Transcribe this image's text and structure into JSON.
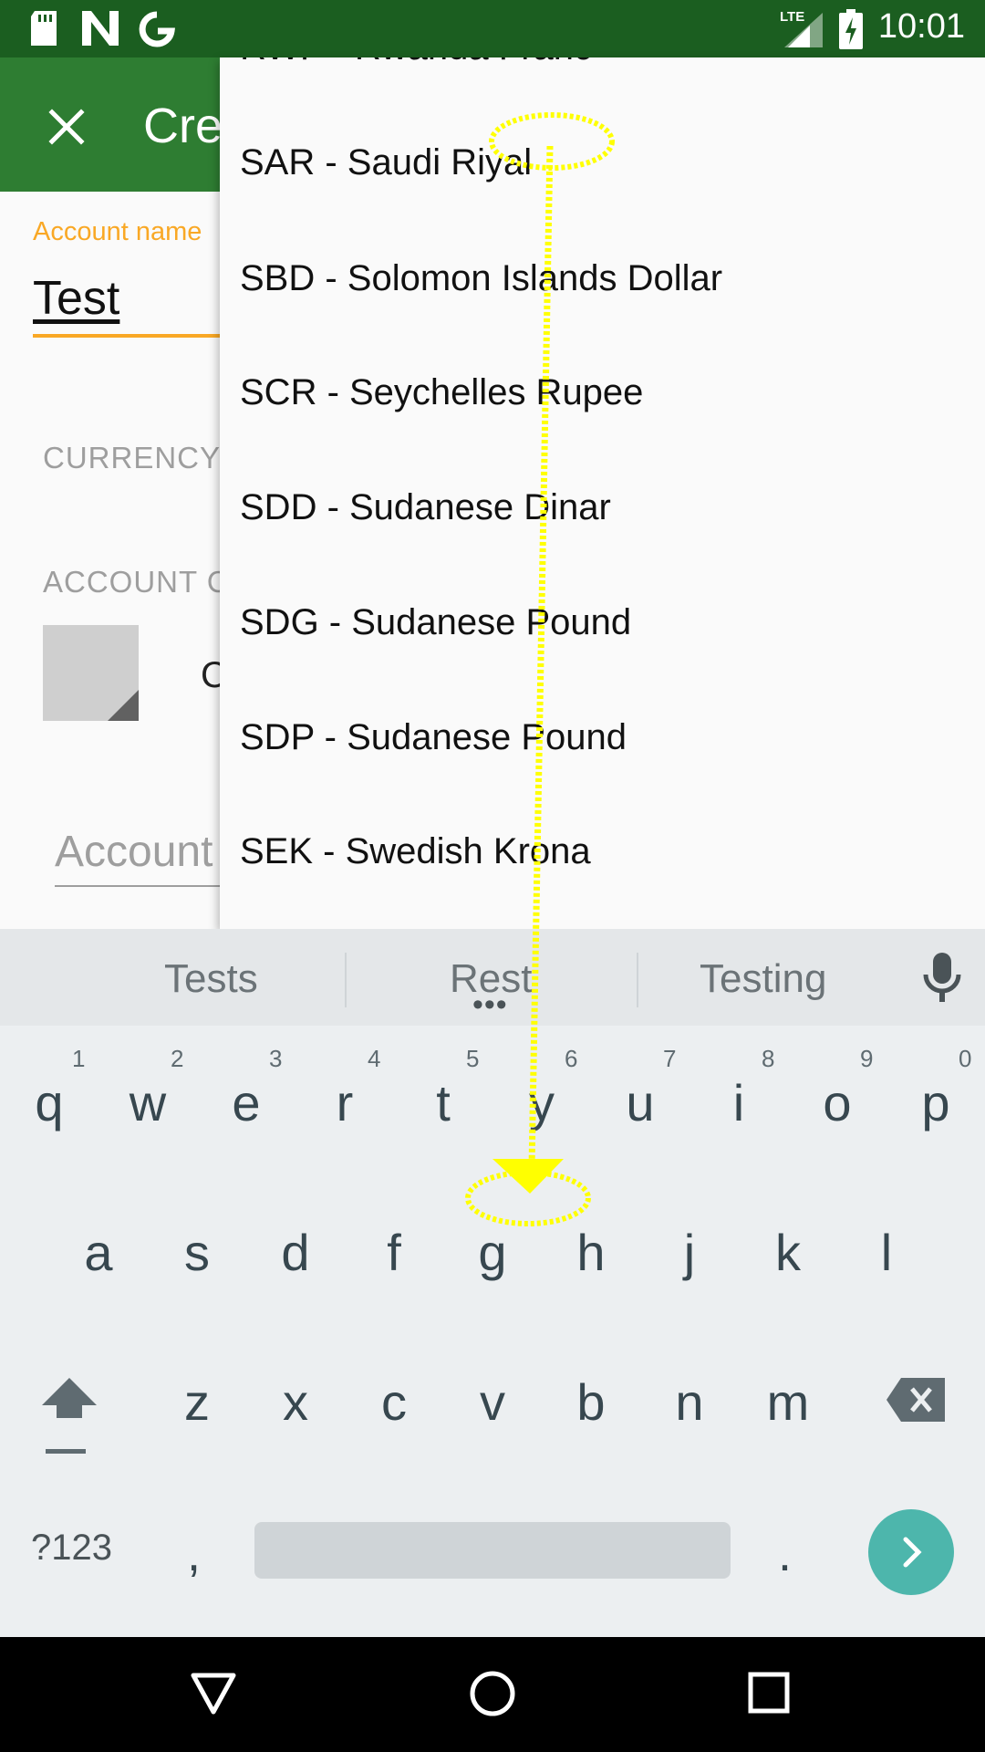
{
  "status_bar": {
    "time": "10:01",
    "network": "LTE",
    "icons": [
      "sd-card-icon",
      "n-notification-icon",
      "google-icon",
      "signal-icon",
      "battery-charging-icon"
    ]
  },
  "app_bar": {
    "title": "Cre",
    "close_icon": "close-icon"
  },
  "form": {
    "account_name_label": "Account name",
    "account_name_value": "Test",
    "currency_label": "CURRENCY",
    "account_color_label": "ACCOUNT C",
    "color_text": "C",
    "description_placeholder": "Account"
  },
  "dropdown": {
    "items": [
      "RWF - Rwanda Franc",
      "SAR - Saudi Riyal",
      "SBD - Solomon Islands Dollar",
      "SCR - Seychelles Rupee",
      "SDD - Sudanese Dinar",
      "SDG - Sudanese Pound",
      "SDP - Sudanese Pound",
      "SEK - Swedish Krona"
    ]
  },
  "keyboard": {
    "suggestions": [
      "Tests",
      "Rest",
      "Testing"
    ],
    "suggestion_more": "•••",
    "row1": [
      "q",
      "w",
      "e",
      "r",
      "t",
      "y",
      "u",
      "i",
      "o",
      "p"
    ],
    "row1_hints": [
      "1",
      "2",
      "3",
      "4",
      "5",
      "6",
      "7",
      "8",
      "9",
      "0"
    ],
    "row2": [
      "a",
      "s",
      "d",
      "f",
      "g",
      "h",
      "j",
      "k",
      "l"
    ],
    "row3": [
      "z",
      "x",
      "c",
      "v",
      "b",
      "n",
      "m"
    ],
    "symbols_key": "?123",
    "comma_key": ",",
    "period_key": "."
  },
  "colors": {
    "status_bar": "#1b5e20",
    "app_bar": "#2e7d32",
    "accent": "#f9a825",
    "enter_key": "#4db6ac",
    "gesture": "#ffff00"
  }
}
